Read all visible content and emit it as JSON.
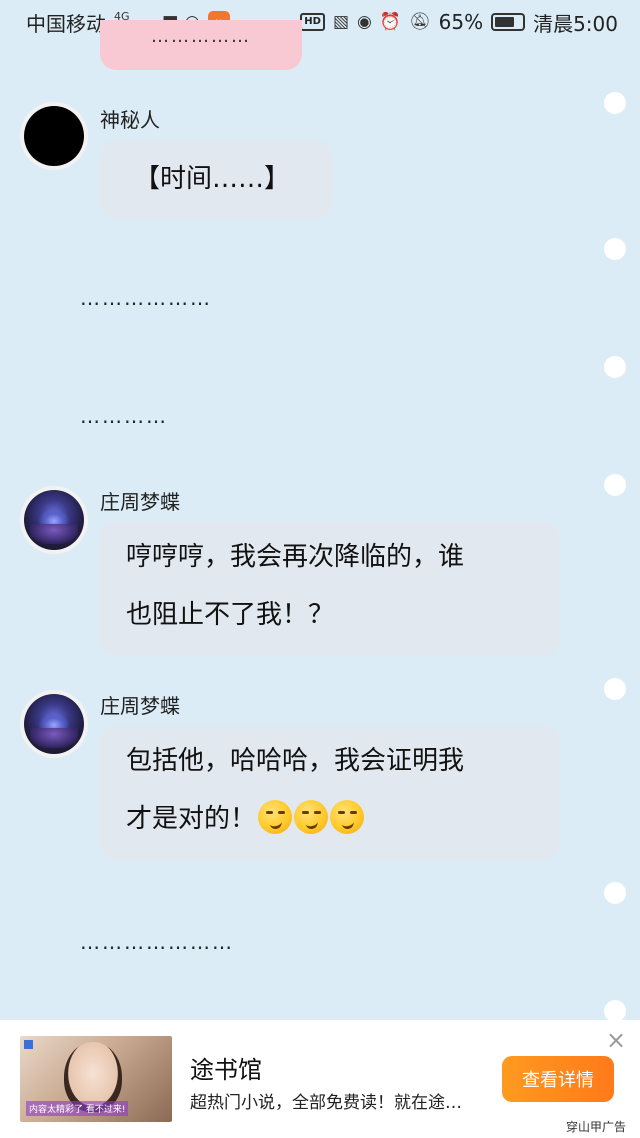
{
  "status_bar": {
    "carrier": "中国移动",
    "network": "4G",
    "battery": "65%",
    "time": "清晨5:00",
    "hd_label": "HD",
    "icons": [
      "signal-icon",
      "wifi-icon",
      "app-icon",
      "hd-icon",
      "sim-off-icon",
      "eye-icon",
      "alarm-icon",
      "mute-icon",
      "battery-icon"
    ]
  },
  "chat": {
    "partial_bubble_text": "……………",
    "messages": [
      {
        "sender": "神秘人",
        "text": "【时间……】",
        "avatar": "black-avatar"
      },
      {
        "type": "narration",
        "text": "………………"
      },
      {
        "type": "narration",
        "text": "…………"
      },
      {
        "sender": "庄周梦蝶",
        "line1": "哼哼哼，我会再次降临的，谁",
        "line2": "也阻止不了我！？",
        "avatar": "robot-avatar"
      },
      {
        "sender": "庄周梦蝶",
        "line1": "包括他，哈哈哈，我会证明我",
        "line2": "才是对的！",
        "emoji": "smirk-emoji",
        "emoji_count": 3,
        "avatar": "robot-avatar"
      },
      {
        "type": "narration",
        "text": "…………………"
      }
    ]
  },
  "ad": {
    "title": "途书馆",
    "description": "超热门小说，全部免费读！就在途…",
    "button_label": "查看详情",
    "close_icon": "×",
    "source": "穿山甲广告",
    "thumb_caption": "内容太精彩了 看不过来!",
    "colors": {
      "button": "#ff8a1c"
    }
  },
  "colors": {
    "background": "#dcecf6",
    "bubble": "#e1e8f0",
    "pink_bubble": "#f8c9d3"
  }
}
